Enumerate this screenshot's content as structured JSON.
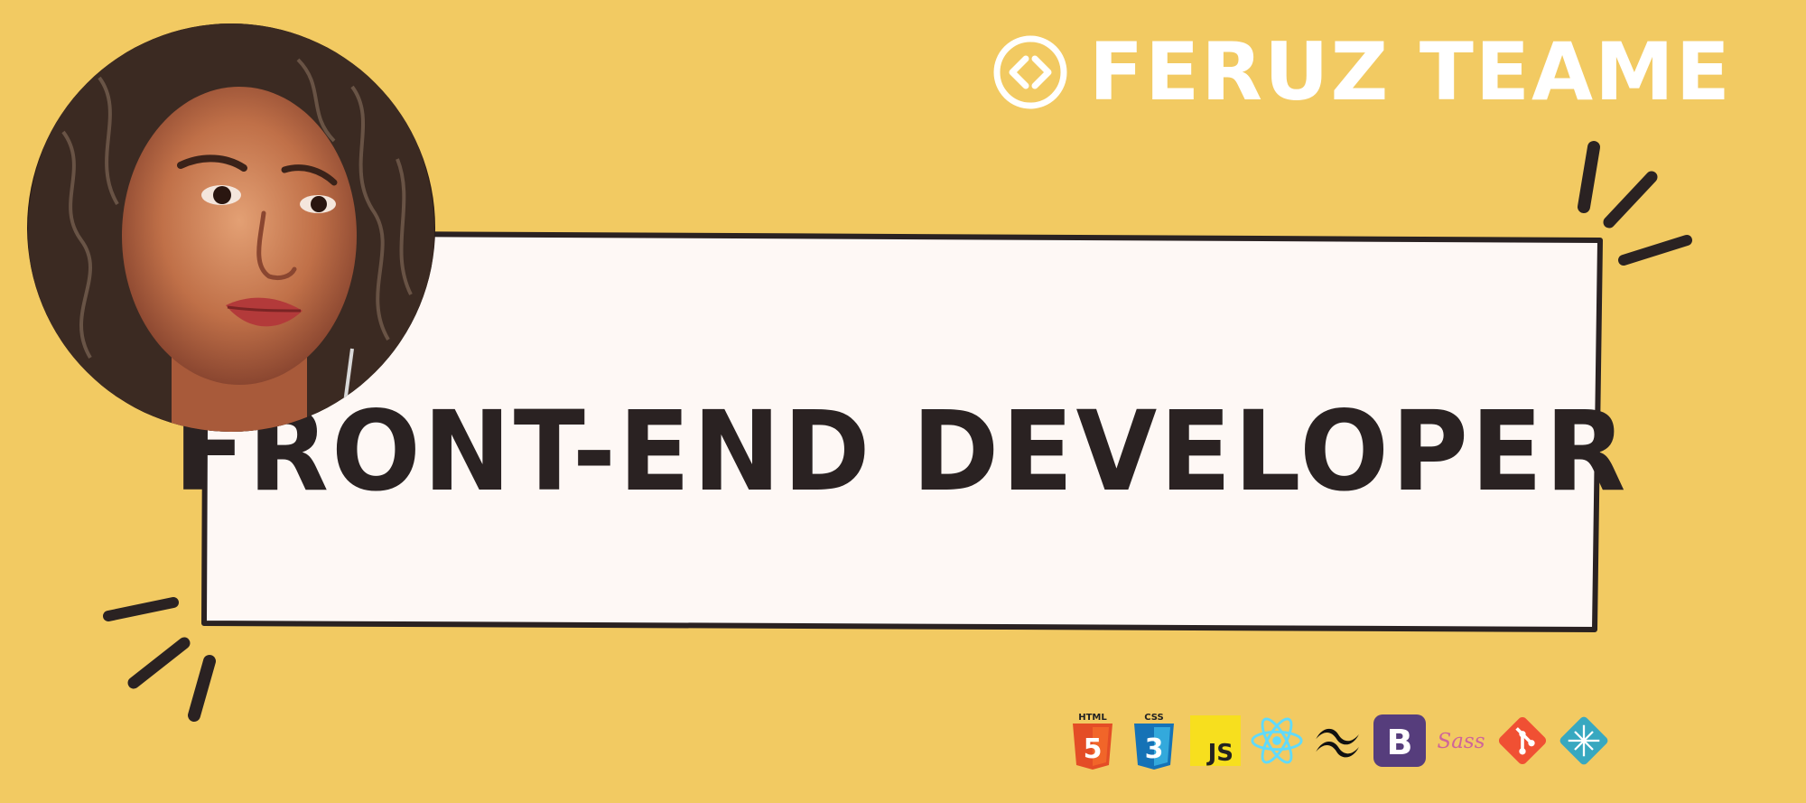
{
  "brand": {
    "name": "FERUZ TEAME",
    "icon": "code-brackets-icon",
    "color": "#FFFFFF"
  },
  "banner": {
    "title": "FRONT-END DEVELOPER",
    "background": "#F2CA62",
    "card_fill": "#FEF8F5",
    "ink": "#2A2222"
  },
  "avatar": {
    "alt": "profile-photo"
  },
  "tech_stack": [
    {
      "name": "html5-icon",
      "label": "HTML",
      "color": "#E44D26"
    },
    {
      "name": "css3-icon",
      "label": "CSS",
      "color": "#1572B6"
    },
    {
      "name": "javascript-icon",
      "label": "JS",
      "color": "#F7DF1E"
    },
    {
      "name": "react-icon",
      "label": "",
      "color": "#61DAFB"
    },
    {
      "name": "tailwind-icon",
      "label": "",
      "color": "#111111"
    },
    {
      "name": "bootstrap-icon",
      "label": "B",
      "color": "#563D7C"
    },
    {
      "name": "sass-icon",
      "label": "Sass",
      "color": "#CF649A"
    },
    {
      "name": "git-icon",
      "label": "",
      "color": "#F05033"
    },
    {
      "name": "netlify-icon",
      "label": "",
      "color": "#38A8C0"
    }
  ]
}
